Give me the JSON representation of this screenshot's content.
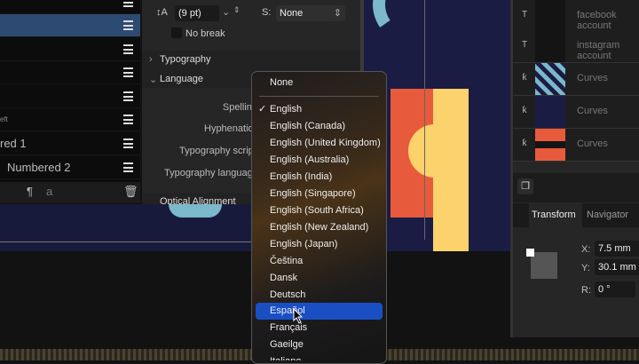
{
  "left_panel": {
    "items": [
      "",
      "",
      "",
      "",
      "",
      "eft",
      "red 1",
      "Numbered 2"
    ]
  },
  "para": {
    "leading_value": "(9 pt)",
    "style_value": "None",
    "no_break": "No break",
    "sections": {
      "typography": "Typography",
      "language": "Language",
      "optical": "Optical Alignment"
    },
    "labels": {
      "spelling": "Spelling",
      "hyphenation": "Hyphenation",
      "typo_script": "Typography script",
      "typo_language": "Typography language"
    }
  },
  "menu": {
    "items": [
      "None",
      "English",
      "English (Canada)",
      "English (United Kingdom)",
      "English (Australia)",
      "English (India)",
      "English (Singapore)",
      "English (South Africa)",
      "English (New Zealand)",
      "English (Japan)",
      "Čeština",
      "Dansk",
      "Deutsch",
      "Español",
      "Français",
      "Gaeilge",
      "Italiano"
    ],
    "checked": "English",
    "highlighted": "Español"
  },
  "layers": [
    {
      "name": "facebook account",
      "thumb_text": "facebook account"
    },
    {
      "name": "instagram account",
      "thumb_text": "instagram account"
    },
    {
      "name": "Curves"
    },
    {
      "name": "Curves"
    },
    {
      "name": "Curves"
    }
  ],
  "transform": {
    "tabs": [
      "Transform",
      "Navigator"
    ],
    "x_label": "X:",
    "x": "7.5 mm",
    "y_label": "Y:",
    "y": "30.1 mm",
    "r_label": "R:",
    "r": "0 °"
  },
  "colors": {
    "accent": "#1a4fc4",
    "selection": "#2d4b72",
    "orange": "#e85a3c",
    "yellow": "#fbd26b",
    "teal": "#7bb8cc",
    "navy": "#1b1c44"
  }
}
